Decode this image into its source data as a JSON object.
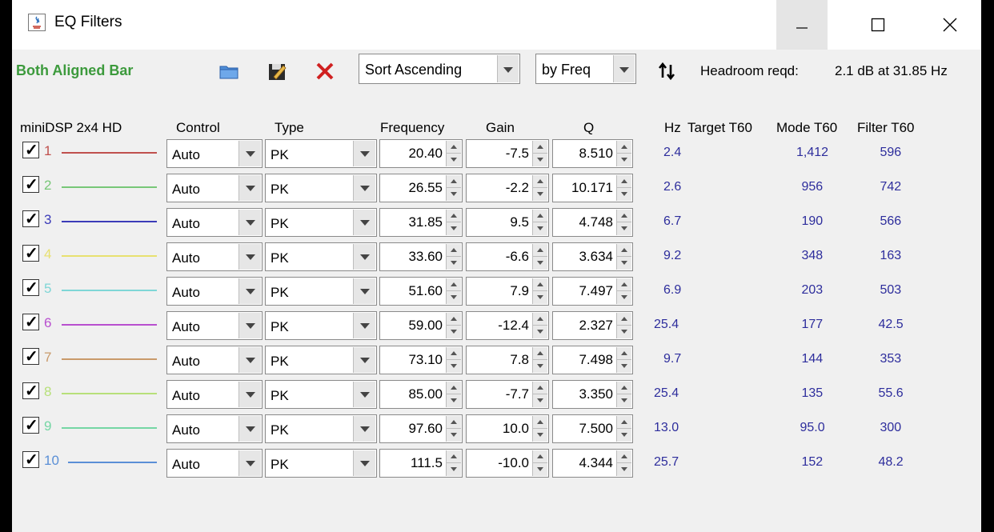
{
  "window": {
    "title": "EQ Filters"
  },
  "toolbar": {
    "mode_label": "Both Aligned Bar",
    "sort_order": "Sort Ascending",
    "sort_by": "by Freq",
    "headroom_label": "Headroom reqd:",
    "headroom_value": "2.1 dB at 31.85 Hz"
  },
  "headers": {
    "device": "miniDSP 2x4 HD",
    "control": "Control",
    "type": "Type",
    "frequency": "Frequency",
    "gain": "Gain",
    "q": "Q",
    "hz": "Hz",
    "target_t60": "Target T60",
    "mode_t60": "Mode T60",
    "filter_t60": "Filter T60"
  },
  "filters": [
    {
      "index": "1",
      "color": "#c0504d",
      "checked": true,
      "control": "Auto",
      "type": "PK",
      "frequency": "20.40",
      "gain": "-7.5",
      "q": "8.510",
      "hz": "2.4",
      "target_t60": "",
      "mode_t60": "1,412",
      "filter_t60": "596"
    },
    {
      "index": "2",
      "color": "#77c777",
      "checked": true,
      "control": "Auto",
      "type": "PK",
      "frequency": "26.55",
      "gain": "-2.2",
      "q": "10.171",
      "hz": "2.6",
      "target_t60": "",
      "mode_t60": "956",
      "filter_t60": "742"
    },
    {
      "index": "3",
      "color": "#3b3bb8",
      "checked": true,
      "control": "Auto",
      "type": "PK",
      "frequency": "31.85",
      "gain": "9.5",
      "q": "4.748",
      "hz": "6.7",
      "target_t60": "",
      "mode_t60": "190",
      "filter_t60": "566"
    },
    {
      "index": "4",
      "color": "#e8e070",
      "checked": true,
      "control": "Auto",
      "type": "PK",
      "frequency": "33.60",
      "gain": "-6.6",
      "q": "3.634",
      "hz": "9.2",
      "target_t60": "",
      "mode_t60": "348",
      "filter_t60": "163"
    },
    {
      "index": "5",
      "color": "#7fd6d6",
      "checked": true,
      "control": "Auto",
      "type": "PK",
      "frequency": "51.60",
      "gain": "7.9",
      "q": "7.497",
      "hz": "6.9",
      "target_t60": "",
      "mode_t60": "203",
      "filter_t60": "503"
    },
    {
      "index": "6",
      "color": "#b84fcf",
      "checked": true,
      "control": "Auto",
      "type": "PK",
      "frequency": "59.00",
      "gain": "-12.4",
      "q": "2.327",
      "hz": "25.4",
      "target_t60": "",
      "mode_t60": "177",
      "filter_t60": "42.5"
    },
    {
      "index": "7",
      "color": "#c99a6a",
      "checked": true,
      "control": "Auto",
      "type": "PK",
      "frequency": "73.10",
      "gain": "7.8",
      "q": "7.498",
      "hz": "9.7",
      "target_t60": "",
      "mode_t60": "144",
      "filter_t60": "353"
    },
    {
      "index": "8",
      "color": "#b7e07a",
      "checked": true,
      "control": "Auto",
      "type": "PK",
      "frequency": "85.00",
      "gain": "-7.7",
      "q": "3.350",
      "hz": "25.4",
      "target_t60": "",
      "mode_t60": "135",
      "filter_t60": "55.6"
    },
    {
      "index": "9",
      "color": "#74d6a4",
      "checked": true,
      "control": "Auto",
      "type": "PK",
      "frequency": "97.60",
      "gain": "10.0",
      "q": "7.500",
      "hz": "13.0",
      "target_t60": "",
      "mode_t60": "95.0",
      "filter_t60": "300"
    },
    {
      "index": "10",
      "color": "#5a8fd6",
      "checked": true,
      "control": "Auto",
      "type": "PK",
      "frequency": "111.5",
      "gain": "-10.0",
      "q": "4.344",
      "hz": "25.7",
      "target_t60": "",
      "mode_t60": "152",
      "filter_t60": "48.2"
    }
  ]
}
